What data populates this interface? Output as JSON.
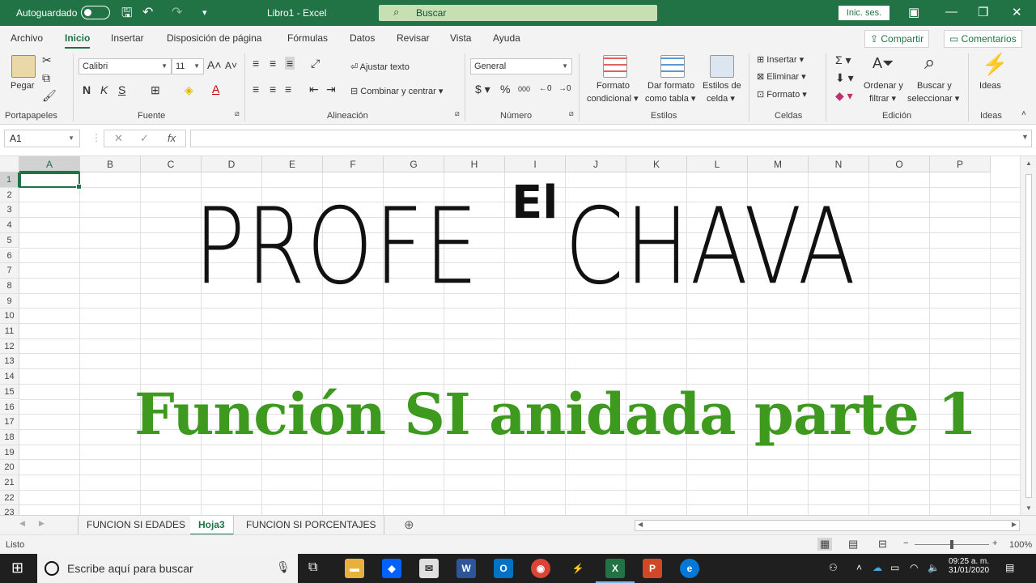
{
  "titlebar": {
    "autosave_label": "Autoguardado",
    "doc_title": "Libro1  -  Excel",
    "search_placeholder": "Buscar",
    "signin_label": "Inic. ses."
  },
  "menu": {
    "tabs": [
      "Archivo",
      "Inicio",
      "Insertar",
      "Disposición de página",
      "Fórmulas",
      "Datos",
      "Revisar",
      "Vista",
      "Ayuda"
    ],
    "active_tab": "Inicio",
    "share_label": "Compartir",
    "comments_label": "Comentarios"
  },
  "ribbon": {
    "paste_label": "Pegar",
    "font_name": "Calibri",
    "font_size": "11",
    "wrap_text": "Ajustar texto",
    "merge_center": "Combinar y centrar",
    "number_format": "General",
    "cond_format": [
      "Formato",
      "condicional"
    ],
    "table_format": [
      "Dar formato",
      "como tabla"
    ],
    "cell_styles": [
      "Estilos de",
      "celda"
    ],
    "insert": "Insertar",
    "delete": "Eliminar",
    "format": "Formato",
    "sort_filter": [
      "Ordenar y",
      "filtrar"
    ],
    "find_select": [
      "Buscar y",
      "seleccionar"
    ],
    "ideas": "Ideas",
    "groups": [
      "Portapapeles",
      "Fuente",
      "Alineación",
      "Número",
      "Estilos",
      "Celdas",
      "Edición",
      "Ideas"
    ]
  },
  "formula": {
    "namebox": "A1",
    "fx": "fx",
    "content": ""
  },
  "grid": {
    "columns": [
      "A",
      "B",
      "C",
      "D",
      "E",
      "F",
      "G",
      "H",
      "I",
      "J",
      "K",
      "L",
      "M",
      "N",
      "O",
      "P"
    ],
    "rows": [
      "1",
      "2",
      "3",
      "4",
      "5",
      "6",
      "7",
      "8",
      "9",
      "10",
      "11",
      "12",
      "13",
      "14",
      "15",
      "16",
      "17",
      "18",
      "19",
      "20",
      "21",
      "22",
      "23"
    ],
    "selected_col": "A",
    "selected_row": "1"
  },
  "overlay": {
    "word1": "PROFE",
    "word_el": "El",
    "word2": "CHAVA",
    "subtitle": "Función SI anidada parte 1",
    "subtitle_color": "#3e9a1f"
  },
  "sheets": {
    "tabs": [
      "FUNCION SI EDADES",
      "Hoja3",
      "FUNCION SI PORCENTAJES"
    ],
    "active": "Hoja3"
  },
  "status": {
    "ready": "Listo",
    "zoom": "100%"
  },
  "taskbar": {
    "search_placeholder": "Escribe aquí para buscar",
    "time": "09:25 a. m.",
    "date": "31/01/2020"
  },
  "colors": {
    "excel_green": "#217346",
    "accent_light": "#c6e0b4"
  }
}
